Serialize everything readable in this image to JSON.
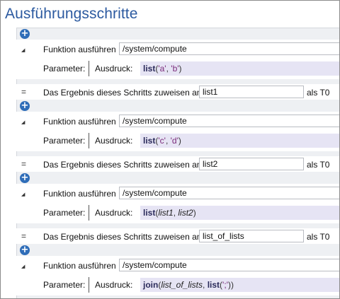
{
  "title": "Ausführungsschritte",
  "labels": {
    "call": "Funktion ausführen",
    "parameters": "Parameter:",
    "expression": "Ausdruck:",
    "assign": "Das Ergebnis dieses Schritts zuweisen an",
    "eq": "="
  },
  "steps": [
    {
      "function_path": "/system/compute",
      "assign_var": "list1",
      "result_name": "als T0",
      "expr": [
        {
          "t": "fn",
          "v": "list"
        },
        {
          "t": "p",
          "v": "("
        },
        {
          "t": "str",
          "v": "'a'"
        },
        {
          "t": "p",
          "v": ", "
        },
        {
          "t": "str",
          "v": "'b'"
        },
        {
          "t": "p",
          "v": ")"
        }
      ]
    },
    {
      "function_path": "/system/compute",
      "assign_var": "list2",
      "result_name": "als T0",
      "expr": [
        {
          "t": "fn",
          "v": "list"
        },
        {
          "t": "p",
          "v": "("
        },
        {
          "t": "str",
          "v": "'c'"
        },
        {
          "t": "p",
          "v": ", "
        },
        {
          "t": "str",
          "v": "'d'"
        },
        {
          "t": "p",
          "v": ")"
        }
      ]
    },
    {
      "function_path": "/system/compute",
      "assign_var": "list_of_lists",
      "result_name": "als T0",
      "expr": [
        {
          "t": "fn",
          "v": "list"
        },
        {
          "t": "p",
          "v": "("
        },
        {
          "t": "var",
          "v": "list1"
        },
        {
          "t": "p",
          "v": ", "
        },
        {
          "t": "var",
          "v": "list2"
        },
        {
          "t": "p",
          "v": ")"
        }
      ]
    },
    {
      "function_path": "/system/compute",
      "expr": [
        {
          "t": "fn",
          "v": "join"
        },
        {
          "t": "p",
          "v": "("
        },
        {
          "t": "var",
          "v": "list_of_lists"
        },
        {
          "t": "p",
          "v": ", "
        },
        {
          "t": "fn",
          "v": "list"
        },
        {
          "t": "p",
          "v": "("
        },
        {
          "t": "str",
          "v": "';'"
        },
        {
          "t": "p",
          "v": "))"
        }
      ]
    }
  ],
  "icons": {
    "add": "plus-circle-icon",
    "collapse": "triangle-collapse-icon"
  },
  "colors": {
    "title": "#2c5aa0",
    "add_button": "#2f6db8",
    "expression_bg": "#e6e4f4"
  }
}
